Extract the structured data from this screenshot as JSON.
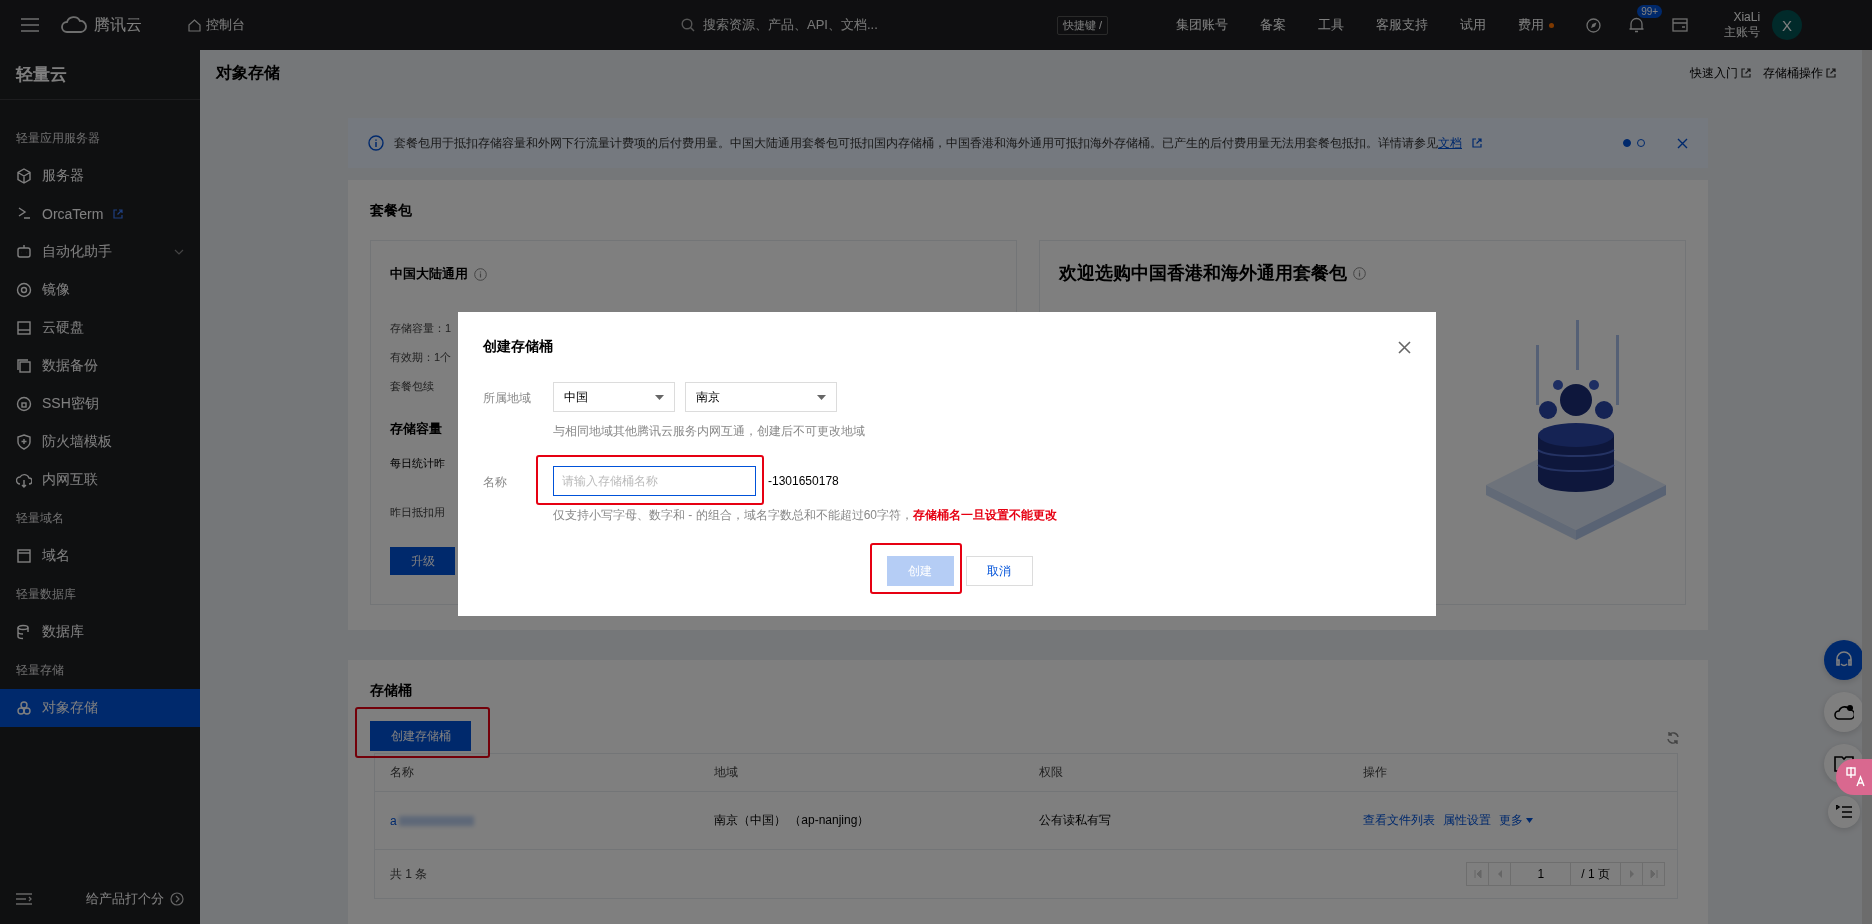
{
  "topbar": {
    "brand": "腾讯云",
    "console": "控制台",
    "search": {
      "placeholder": "搜索资源、产品、API、文档..."
    },
    "shortcut": "快捷键 /",
    "nav": [
      {
        "label": "集团账号",
        "dot": false
      },
      {
        "label": "备案",
        "dot": false
      },
      {
        "label": "工具",
        "dot": false
      },
      {
        "label": "客服支持",
        "dot": false
      },
      {
        "label": "试用",
        "dot": false
      },
      {
        "label": "费用",
        "dot": true
      }
    ],
    "notifications": "99+",
    "user": {
      "name": "XiaLi",
      "role": "主账号",
      "avatar": "X"
    }
  },
  "sidebar": {
    "title": "轻量云",
    "groups": [
      {
        "label": "轻量应用服务器",
        "items": [
          {
            "label": "服务器",
            "selected": false
          },
          {
            "label": "OrcaTerm",
            "selected": false,
            "external": true
          },
          {
            "label": "自动化助手",
            "selected": false,
            "expandable": true
          },
          {
            "label": "镜像",
            "selected": false
          },
          {
            "label": "云硬盘",
            "selected": false
          },
          {
            "label": "数据备份",
            "selected": false
          },
          {
            "label": "SSH密钥",
            "selected": false
          },
          {
            "label": "防火墙模板",
            "selected": false
          },
          {
            "label": "内网互联",
            "selected": false
          }
        ]
      },
      {
        "label": "轻量域名",
        "items": [
          {
            "label": "域名",
            "selected": false
          }
        ]
      },
      {
        "label": "轻量数据库",
        "items": [
          {
            "label": "数据库",
            "selected": false
          }
        ]
      },
      {
        "label": "轻量存储",
        "items": [
          {
            "label": "对象存储",
            "selected": true
          }
        ]
      }
    ],
    "footer": "给产品打个分"
  },
  "page": {
    "title": "对象存储",
    "links": [
      "快速入门",
      "存储桶操作"
    ]
  },
  "banner": {
    "text": "套餐包用于抵扣存储容量和外网下行流量计费项的后付费用量。中国大陆通用套餐包可抵扣国内存储桶，中国香港和海外通用可抵扣海外存储桶。已产生的后付费用量无法用套餐包抵扣。详情请参见",
    "link": "文档",
    "dots": [
      {
        "selected": true
      },
      {
        "selected": false
      }
    ]
  },
  "package_card": {
    "title": "套餐包",
    "mainland": {
      "title": "中国大陆通用",
      "lines": [
        "存储容量：1",
        "有效期：1个",
        "套餐包续"
      ],
      "capacity_title": "存储容量",
      "capacity_lines": [
        "每日统计昨",
        "昨日抵扣用"
      ],
      "button": "升级"
    },
    "overseas": {
      "title": "欢迎选购中国香港和海外通用套餐包"
    }
  },
  "bucket_card": {
    "title": "存储桶",
    "create_button": "创建存储桶",
    "table": {
      "columns": [
        "名称",
        "地域",
        "权限",
        "操作"
      ],
      "rows": [
        {
          "name": "a",
          "region": "南京（中国） （ap-nanjing）",
          "access": "公有读私有写",
          "actions": [
            "查看文件列表",
            "属性设置",
            "更多"
          ]
        }
      ]
    },
    "total": "共 1 条",
    "pagination": {
      "page": "1",
      "pages": "/ 1 页"
    }
  },
  "dialog": {
    "title": "创建存储桶",
    "region": {
      "label": "所属地域",
      "country": "中国",
      "city": "南京",
      "hint": "与相同地域其他腾讯云服务内网互通，创建后不可更改地域"
    },
    "name": {
      "label": "名称",
      "placeholder": "请输入存储桶名称",
      "suffix": "-1301650178",
      "hint": "仅支持小写字母、数字和 - 的组合，域名字数总和不能超过60字符，",
      "warning": "存储桶名一旦设置不能更改"
    },
    "buttons": [
      {
        "label": "创建",
        "kind": "primary",
        "disabled": true
      },
      {
        "label": "取消",
        "kind": "secondary",
        "disabled": false
      }
    ]
  }
}
